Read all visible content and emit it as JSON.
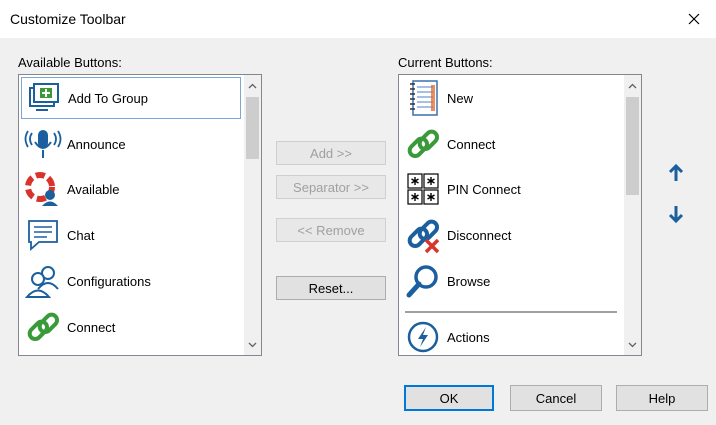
{
  "window": {
    "title": "Customize Toolbar"
  },
  "available": {
    "label": "Available Buttons:",
    "items": [
      {
        "label": "Add To Group",
        "icon": "add-to-group-icon"
      },
      {
        "label": "Announce",
        "icon": "announce-icon"
      },
      {
        "label": "Available",
        "icon": "available-icon"
      },
      {
        "label": "Chat",
        "icon": "chat-icon"
      },
      {
        "label": "Configurations",
        "icon": "configurations-icon"
      },
      {
        "label": "Connect",
        "icon": "connect-icon"
      }
    ]
  },
  "current": {
    "label": "Current Buttons:",
    "items": [
      {
        "label": "New",
        "icon": "new-icon"
      },
      {
        "label": "Connect",
        "icon": "connect-icon"
      },
      {
        "label": "PIN Connect",
        "icon": "pin-connect-icon"
      },
      {
        "label": "Disconnect",
        "icon": "disconnect-icon"
      },
      {
        "label": "Browse",
        "icon": "browse-icon"
      },
      {
        "label": "Actions",
        "icon": "actions-icon"
      }
    ]
  },
  "middle": {
    "add": "Add >>",
    "separator": "Separator >>",
    "remove": "<< Remove",
    "reset": "Reset..."
  },
  "footer": {
    "ok": "OK",
    "cancel": "Cancel",
    "help": "Help"
  },
  "colors": {
    "accent": "#0078d7",
    "icon_blue": "#1c5f9e",
    "icon_green": "#3a9a3a",
    "icon_red": "#d9342b"
  }
}
